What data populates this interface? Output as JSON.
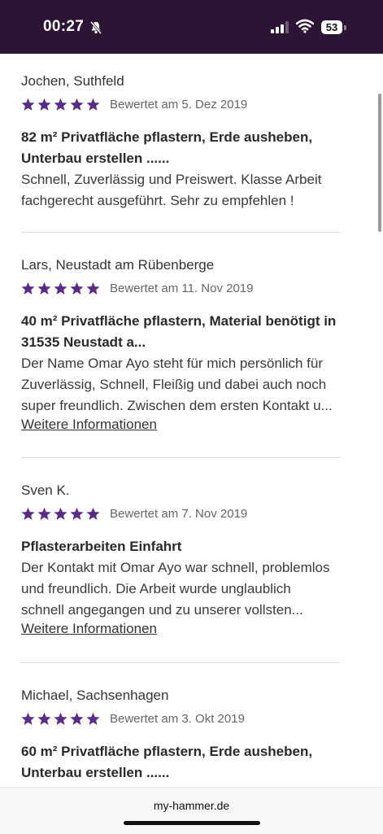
{
  "status_bar": {
    "time": "00:27",
    "battery": "53"
  },
  "colors": {
    "status_bar_bg": "#2c1434",
    "star": "#5b2a86"
  },
  "reviews": [
    {
      "reviewer": "Jochen, Suthfeld",
      "stars": 5,
      "date": "Bewertet am 5. Dez 2019",
      "title_lines": [
        "82 m² Privatfläche pflastern, Erde ausheben,",
        "Unterbau erstellen ......"
      ],
      "body_lines": [
        "Schnell, Zuverlässig und Preiswert. Klasse Arbeit",
        "fachgerecht ausgeführt. Sehr zu empfehlen !"
      ],
      "more": ""
    },
    {
      "reviewer": "Lars, Neustadt am Rübenberge",
      "stars": 5,
      "date": "Bewertet am 11. Nov 2019",
      "title_lines": [
        "40 m² Privatfläche pflastern, Material benötigt in",
        "31535 Neustadt a..."
      ],
      "body_lines": [
        "Der Name Omar Ayo steht für mich persönlich für",
        "Zuverlässig, Schnell, Fleißig und dabei auch noch",
        "super freundlich. Zwischen dem ersten Kontakt u..."
      ],
      "more": "Weitere Informationen"
    },
    {
      "reviewer": "Sven K.",
      "stars": 5,
      "date": "Bewertet am 7. Nov 2019",
      "title_lines": [
        "Pflasterarbeiten Einfahrt"
      ],
      "body_lines": [
        "Der Kontakt mit Omar Ayo war schnell, problemlos",
        "und freundlich. Die Arbeit wurde unglaublich",
        "schnell angegangen und zu unserer vollsten..."
      ],
      "more": "Weitere Informationen"
    },
    {
      "reviewer": "Michael, Sachsenhagen",
      "stars": 5,
      "date": "Bewertet am 3. Okt 2019",
      "title_lines": [
        "60 m² Privatfläche pflastern, Erde ausheben,",
        "Unterbau erstellen ......"
      ],
      "body_lines": [],
      "more": ""
    }
  ],
  "browser": {
    "url": "my-hammer.de"
  }
}
